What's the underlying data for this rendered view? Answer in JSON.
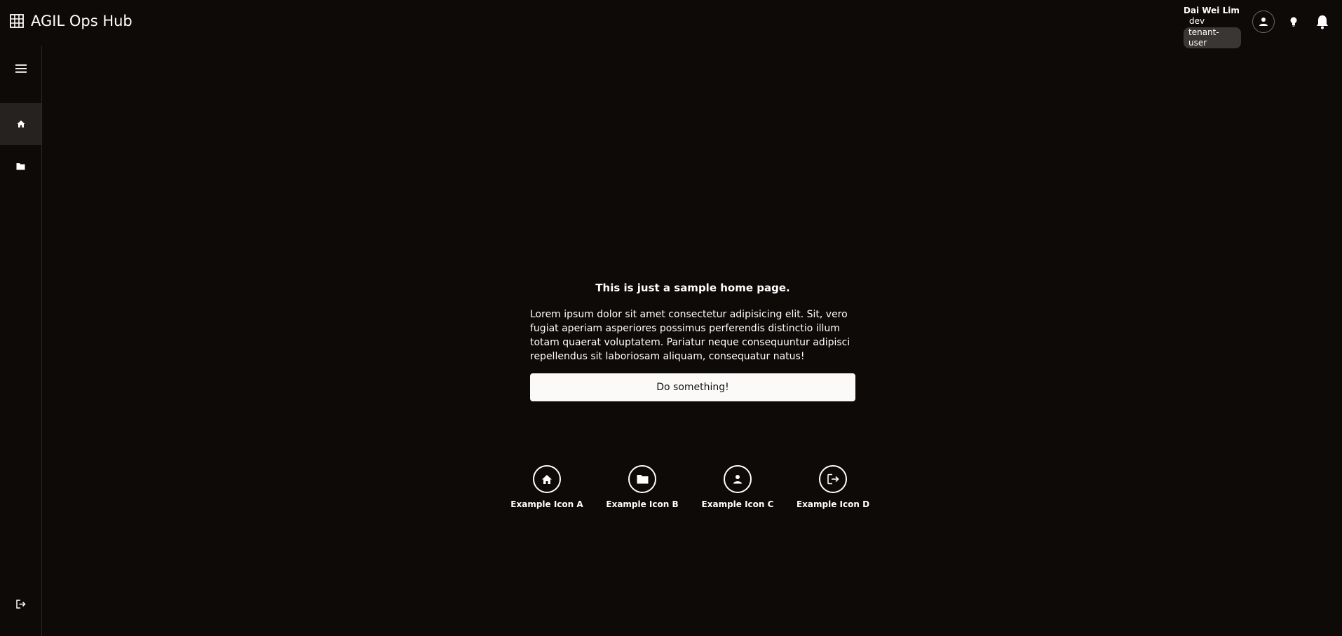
{
  "header": {
    "app_title": "AGIL Ops Hub",
    "user": {
      "name": "Dai Wei Lim",
      "environment": "dev",
      "role": "tenant-user"
    },
    "icons": [
      "app-grid-icon",
      "account-icon",
      "lightbulb-icon",
      "bell-icon"
    ]
  },
  "sidebar": {
    "items": [
      {
        "name": "menu",
        "icon": "hamburger-menu-icon"
      },
      {
        "name": "home",
        "icon": "home-icon",
        "active": true
      },
      {
        "name": "files",
        "icon": "folder-icon"
      },
      {
        "name": "logout",
        "icon": "logout-icon"
      }
    ]
  },
  "main": {
    "heading": "This is just a sample home page.",
    "body": "Lorem ipsum dolor sit amet consectetur adipisicing elit. Sit, vero fugiat aperiam asperiores possimus perferendis distinctio illum totam quaerat voluptatem. Pariatur neque consequuntur adipisci repellendus sit laboriosam aliquam, consequatur natus!",
    "button_label": "Do something!",
    "icons": [
      {
        "label": "Example Icon A",
        "icon": "home-icon"
      },
      {
        "label": "Example Icon B",
        "icon": "folder-icon"
      },
      {
        "label": "Example Icon C",
        "icon": "person-icon"
      },
      {
        "label": "Example Icon D",
        "icon": "logout-icon"
      }
    ]
  },
  "colors": {
    "background": "#0d0a08",
    "sidebar_active": "#262220",
    "button_bg": "#fbfaf8",
    "text": "#ffffff"
  }
}
